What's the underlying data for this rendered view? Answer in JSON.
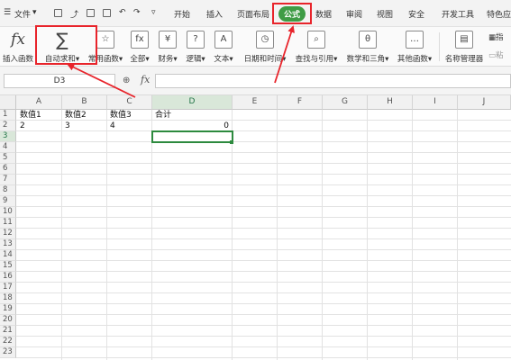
{
  "menu": {
    "file_label": "文件",
    "tabs": [
      {
        "label": "开始",
        "active": false
      },
      {
        "label": "插入",
        "active": false
      },
      {
        "label": "页面布局",
        "active": false
      },
      {
        "label": "公式",
        "active": true
      },
      {
        "label": "数据",
        "active": false
      },
      {
        "label": "审阅",
        "active": false
      },
      {
        "label": "视图",
        "active": false
      },
      {
        "label": "安全",
        "active": false
      },
      {
        "label": "开发工具",
        "active": false
      },
      {
        "label": "特色应",
        "active": false
      }
    ]
  },
  "ribbon": {
    "buttons": [
      {
        "label": "插入函数",
        "icon": "function-icon",
        "glyph": "fx"
      },
      {
        "label": "自动求和",
        "icon": "sigma-icon",
        "glyph": "∑"
      },
      {
        "label": "常用函数",
        "icon": "star-function-icon",
        "glyph": "☆"
      },
      {
        "label": "全部",
        "icon": "fx-box-icon",
        "glyph": "fx"
      },
      {
        "label": "财务",
        "icon": "yen-icon",
        "glyph": "¥"
      },
      {
        "label": "逻辑",
        "icon": "logic-icon",
        "glyph": "?"
      },
      {
        "label": "文本",
        "icon": "text-icon",
        "glyph": "A"
      },
      {
        "label": "日期和时间",
        "icon": "clock-icon",
        "glyph": "◷"
      },
      {
        "label": "查找与引用",
        "icon": "lookup-icon",
        "glyph": "⌕"
      },
      {
        "label": "数学和三角",
        "icon": "math-icon",
        "glyph": "θ"
      },
      {
        "label": "其他函数",
        "icon": "more-icon",
        "glyph": "…"
      },
      {
        "label": "名称管理器",
        "icon": "name-manager-icon",
        "glyph": "▤"
      },
      {
        "label": "指",
        "icon": "specify-icon",
        "glyph": "▦"
      },
      {
        "label": "粘",
        "icon": "paste-icon",
        "glyph": "▭"
      }
    ]
  },
  "formula_bar": {
    "name_box": "D3",
    "fx_label": "fx",
    "content": ""
  },
  "sheet": {
    "columns": [
      "A",
      "B",
      "C",
      "D",
      "E",
      "F",
      "G",
      "H",
      "I",
      "J"
    ],
    "rows": [
      "1",
      "2",
      "3",
      "4",
      "5",
      "6",
      "7",
      "8",
      "9",
      "10",
      "11",
      "12",
      "13",
      "14",
      "15",
      "16",
      "17",
      "18",
      "19",
      "20",
      "21",
      "22",
      "23"
    ],
    "cells": {
      "A1": "数值1",
      "B1": "数值2",
      "C1": "数值3",
      "D1": "合计",
      "A2": "2",
      "B2": "3",
      "C2": "4",
      "D2": "0"
    },
    "selected_cell": "D3"
  },
  "colors": {
    "accent_green": "#3e9c45",
    "annotation_red": "#e8242b"
  }
}
